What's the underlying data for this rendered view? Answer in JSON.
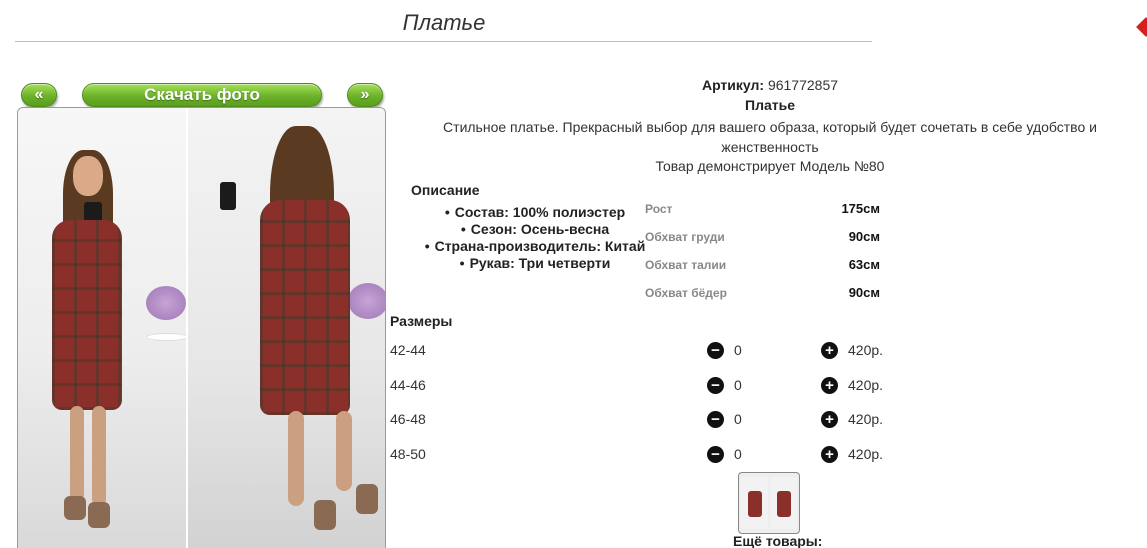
{
  "page": {
    "title": "Платье"
  },
  "gallery": {
    "prev_label": "«",
    "download_label": "Скачать фото",
    "next_label": "»"
  },
  "product": {
    "article_label": "Артикул:",
    "article_value": "961772857",
    "name": "Платье",
    "description": "Стильное платье. Прекрасный выбор для вашего образа, который будет сочетать в себе удобство и женственность",
    "model_note": "Товар демонстрирует Модель №80"
  },
  "details": {
    "title": "Описание",
    "items": [
      "Состав: 100% полиэстер",
      "Сезон: Осень-весна",
      "Страна-производитель: Китай",
      "Рукав: Три четверти"
    ]
  },
  "measurements": [
    {
      "label": "Рост",
      "value": "175см"
    },
    {
      "label": "Обхват груди",
      "value": "90см"
    },
    {
      "label": "Обхват талии",
      "value": "63см"
    },
    {
      "label": "Обхват бёдер",
      "value": "90см"
    }
  ],
  "sizes": {
    "title": "Размеры",
    "rows": [
      {
        "size": "42-44",
        "qty": "0",
        "price": "420р."
      },
      {
        "size": "44-46",
        "qty": "0",
        "price": "420р."
      },
      {
        "size": "46-48",
        "qty": "0",
        "price": "420р."
      },
      {
        "size": "48-50",
        "qty": "0",
        "price": "420р."
      }
    ],
    "minus_icon": "−",
    "plus_icon": "+"
  },
  "more": {
    "title": "Ещё товары:"
  },
  "colors": {
    "accent_green": "#6cb22a",
    "dress_red": "#8a2f2a",
    "badge_red": "#d32020"
  }
}
